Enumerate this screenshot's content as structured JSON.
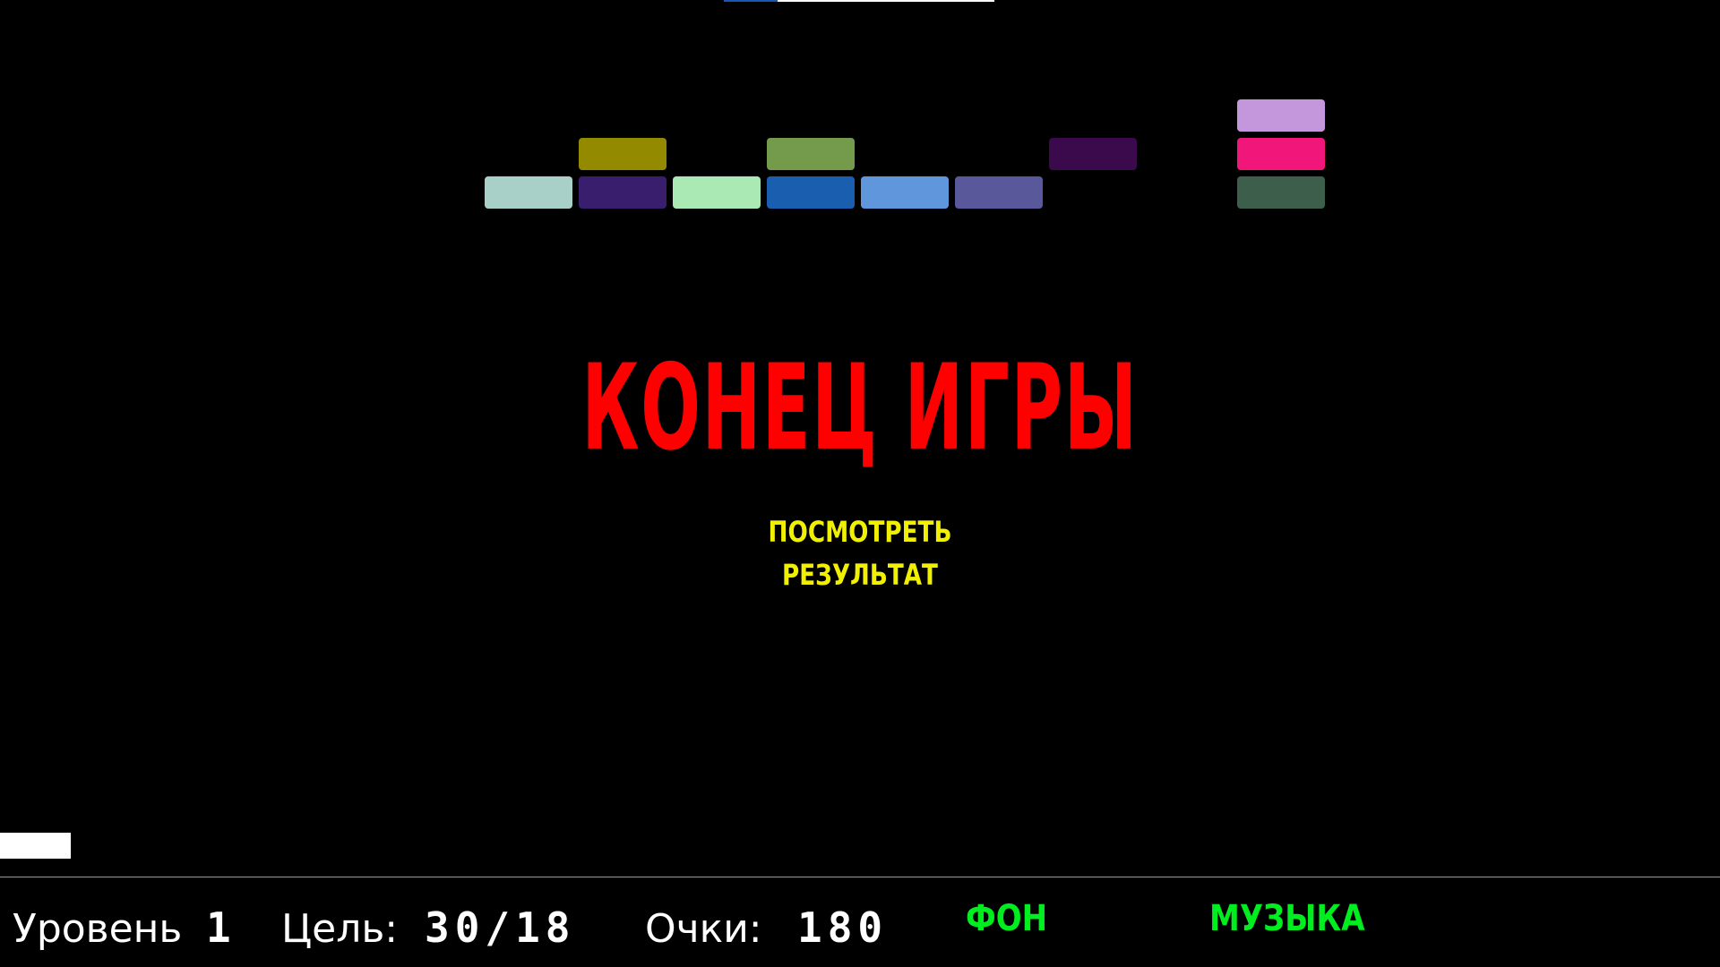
{
  "top_progress": {
    "fill_fraction": 0.2
  },
  "colors": {
    "background": "#000000",
    "game_over": "#ff0000",
    "results_link": "#f0f000",
    "hud_text": "#ffffff",
    "hud_buttons": "#00ee20",
    "paddle": "#ffffff",
    "progress_fill": "#1a56b4",
    "progress_track": "#ffffff"
  },
  "bricks": [
    {
      "col": 8,
      "row": 0,
      "color": "#c497dc"
    },
    {
      "col": 1,
      "row": 1,
      "color": "#938a00"
    },
    {
      "col": 3,
      "row": 1,
      "color": "#749a4c"
    },
    {
      "col": 6,
      "row": 1,
      "color": "#3b0a4c"
    },
    {
      "col": 8,
      "row": 1,
      "color": "#f0167a"
    },
    {
      "col": 0,
      "row": 2,
      "color": "#a8d0c8"
    },
    {
      "col": 1,
      "row": 2,
      "color": "#3a1e6e"
    },
    {
      "col": 2,
      "row": 2,
      "color": "#aae8b4"
    },
    {
      "col": 3,
      "row": 2,
      "color": "#1a5eb0"
    },
    {
      "col": 4,
      "row": 2,
      "color": "#6096dc"
    },
    {
      "col": 5,
      "row": 2,
      "color": "#58589a"
    },
    {
      "col": 8,
      "row": 2,
      "color": "#3e5e4c"
    }
  ],
  "overlay": {
    "title": "КОНЕЦ ИГРЫ",
    "results_line1": "ПОСМОТРЕТЬ",
    "results_line2": "РЕЗУЛЬТАТ"
  },
  "hud": {
    "level_label": "Уровень",
    "level_value": "1",
    "goal_label": "Цель:",
    "goal_value": "30/18",
    "score_label": "Очки:",
    "score_value": "180",
    "background_button": "ФОН",
    "music_button": "МУЗЫКА"
  }
}
